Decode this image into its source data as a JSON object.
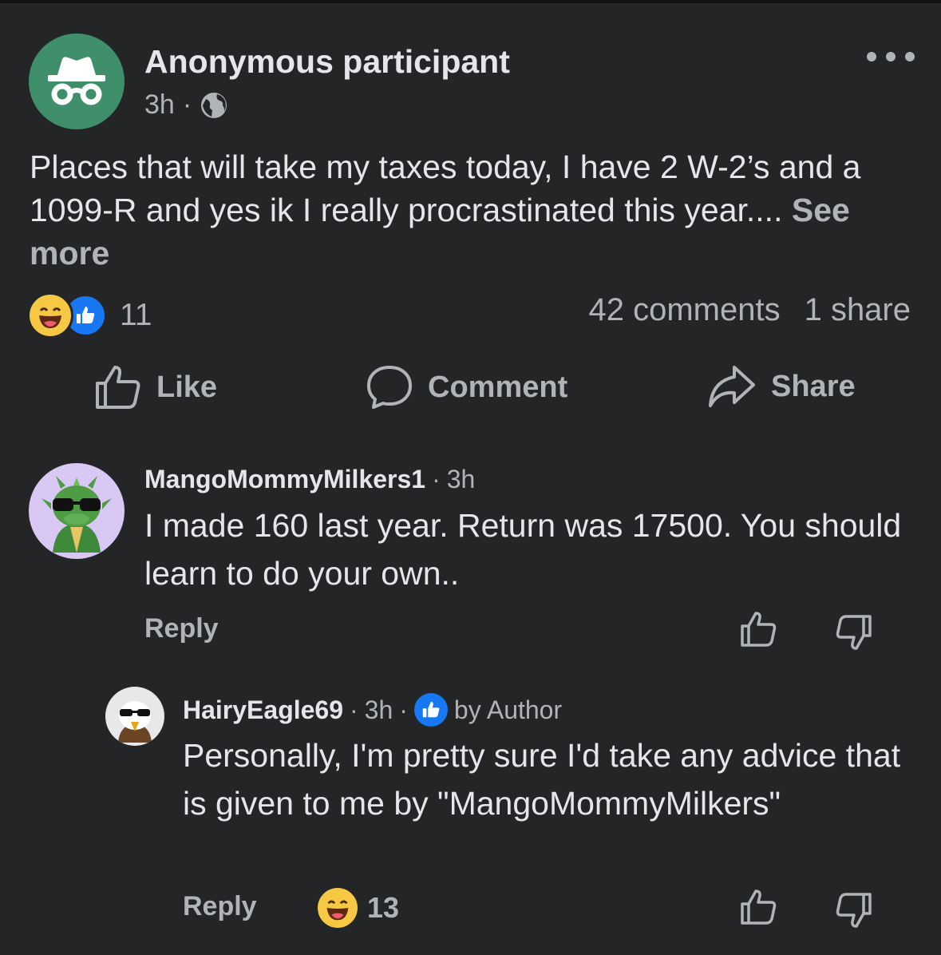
{
  "post": {
    "author": "Anonymous participant",
    "time": "3h",
    "separator": "·",
    "text": "Places that will take my taxes today, I have 2 W-2’s and a 1099-R and yes ik I really procrastinated this year....",
    "see_more": "See more",
    "reactions": {
      "types": [
        "laugh",
        "like"
      ],
      "count": "11"
    },
    "comments_count": "42 comments",
    "shares_count": "1 share",
    "actions": {
      "like": "Like",
      "comment": "Comment",
      "share": "Share"
    }
  },
  "comments": [
    {
      "author": "MangoMommyMilkers1",
      "separator": "·",
      "time": "3h",
      "text": "I made 160 last year. Return was 17500. You should learn to do your own..",
      "reply_label": "Reply"
    },
    {
      "author": "HairyEagle69",
      "separator": "·",
      "time": "3h",
      "separator2": "·",
      "badge": "by Author",
      "text": "Personally, I'm pretty sure I'd take any advice that is given to me by \"MangoMommyMilkers\"",
      "reply_label": "Reply",
      "reaction_count": "13"
    }
  ],
  "colors": {
    "background": "#242526",
    "text_primary": "#e4e6eb",
    "text_secondary": "#b0b3b8",
    "accent_blue": "#1877f2",
    "anonymous_avatar": "#3f8f6b"
  }
}
